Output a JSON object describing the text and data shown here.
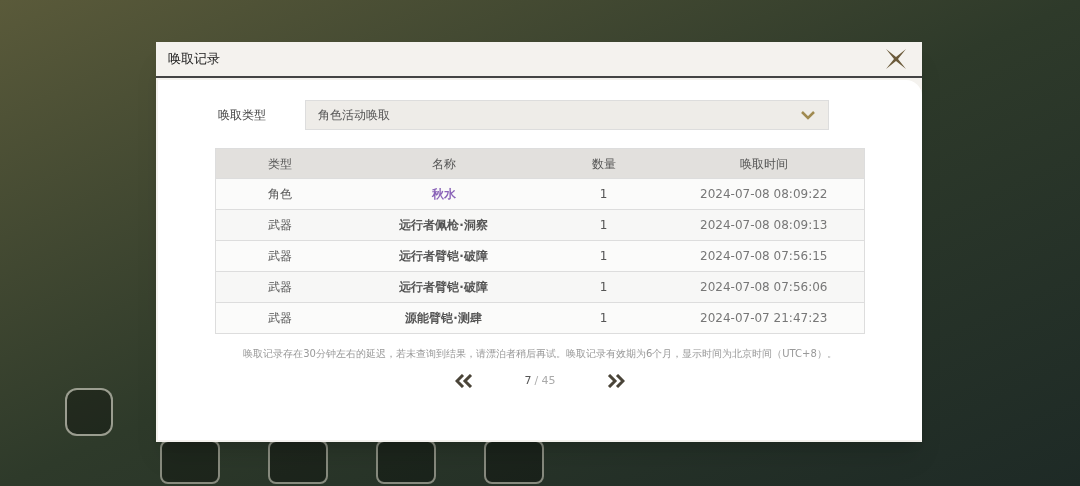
{
  "dialog": {
    "title": "唤取记录"
  },
  "filter": {
    "label": "唤取类型",
    "value": "角色活动唤取"
  },
  "table": {
    "columns": [
      "类型",
      "名称",
      "数量",
      "唤取时间"
    ],
    "rows": [
      {
        "type": "角色",
        "name": "秋水",
        "color": "#8a63b8",
        "count": "1",
        "time": "2024-07-08 08:09:22"
      },
      {
        "type": "武器",
        "name": "远行者佩枪·洞察",
        "color": "#555555",
        "count": "1",
        "time": "2024-07-08 08:09:13"
      },
      {
        "type": "武器",
        "name": "远行者臂铠·破障",
        "color": "#555555",
        "count": "1",
        "time": "2024-07-08 07:56:15"
      },
      {
        "type": "武器",
        "name": "远行者臂铠·破障",
        "color": "#555555",
        "count": "1",
        "time": "2024-07-08 07:56:06"
      },
      {
        "type": "武器",
        "name": "源能臂铠·测肆",
        "color": "#555555",
        "count": "1",
        "time": "2024-07-07 21:47:23"
      }
    ]
  },
  "note": "唤取记录存在30分钟左右的延迟，若未查询到结果，请漂泊者稍后再试。唤取记录有效期为6个月，显示时间为北京时间（UTC+8）。",
  "pagination": {
    "current": "7",
    "total": "/ 45"
  }
}
